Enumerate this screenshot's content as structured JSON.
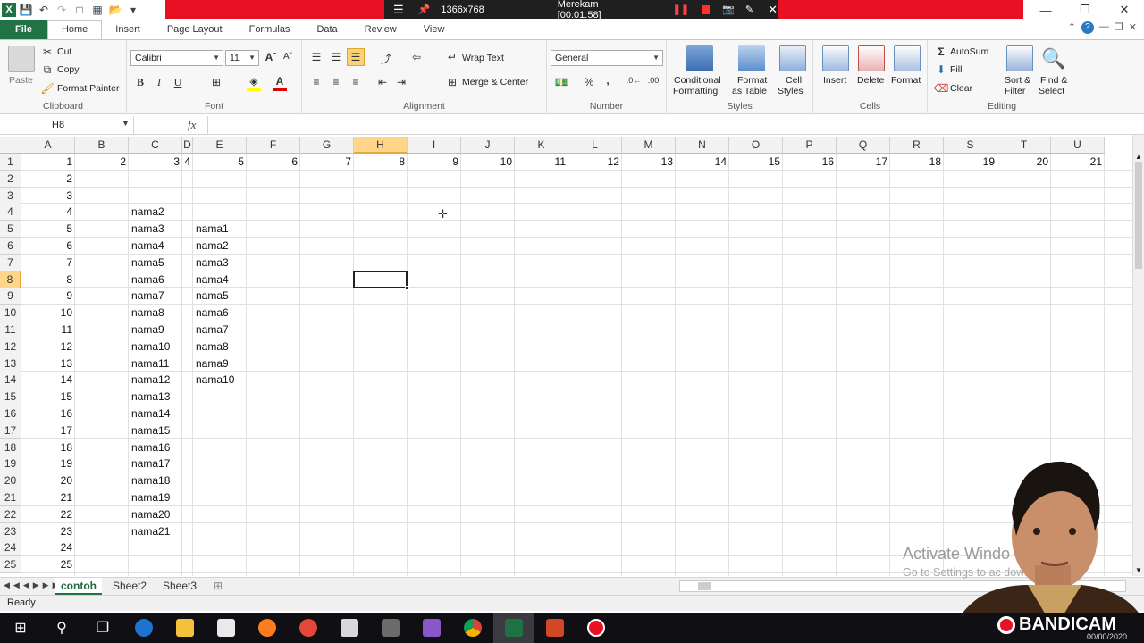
{
  "app": {
    "file_tab": "File",
    "tabs": [
      "Home",
      "Insert",
      "Page Layout",
      "Formulas",
      "Data",
      "Review",
      "View"
    ],
    "active_tab": "Home"
  },
  "recorder": {
    "resolution": "1366x768",
    "status": "Merekam [00:01:58]",
    "brand": "BANDICAM",
    "timestamp_partial": "00/00/2020"
  },
  "ribbon": {
    "clipboard": {
      "label": "Clipboard",
      "paste": "Paste",
      "cut": "Cut",
      "copy": "Copy",
      "format_painter": "Format Painter"
    },
    "font": {
      "label": "Font",
      "name": "Calibri",
      "size": "11",
      "bold": "B",
      "italic": "I",
      "underline": "U"
    },
    "alignment": {
      "label": "Alignment",
      "wrap_text": "Wrap Text",
      "merge_center": "Merge & Center"
    },
    "number": {
      "label": "Number",
      "format": "General",
      "percent": "%",
      "comma": ","
    },
    "styles": {
      "label": "Styles",
      "conditional_1": "Conditional",
      "conditional_2": "Formatting",
      "format_table_1": "Format",
      "format_table_2": "as Table",
      "cell_styles_1": "Cell",
      "cell_styles_2": "Styles"
    },
    "cells": {
      "label": "Cells",
      "insert": "Insert",
      "delete": "Delete",
      "format": "Format"
    },
    "editing": {
      "label": "Editing",
      "autosum": "AutoSum",
      "fill": "Fill",
      "clear": "Clear",
      "sort_1": "Sort &",
      "sort_2": "Filter",
      "find_1": "Find &",
      "find_2": "Select"
    }
  },
  "formula_bar": {
    "name_box": "H8",
    "fx": "fx",
    "content": ""
  },
  "grid": {
    "columns": [
      "A",
      "B",
      "C",
      "D",
      "E",
      "F",
      "G",
      "H",
      "I",
      "J",
      "K",
      "L",
      "M",
      "N",
      "O",
      "P",
      "Q",
      "R",
      "S",
      "T",
      "U"
    ],
    "selected_col": "H",
    "selected_row": 8,
    "rows": [
      "1",
      "2",
      "3",
      "4",
      "5",
      "6",
      "7",
      "8",
      "9",
      "10",
      "11",
      "12",
      "13",
      "14",
      "15",
      "16",
      "17",
      "18",
      "19",
      "20",
      "21",
      "22",
      "23",
      "24",
      "25"
    ],
    "row1_values": [
      "1",
      "2",
      "3",
      "4",
      "5",
      "6",
      "7",
      "8",
      "9",
      "10",
      "11",
      "12",
      "13",
      "14",
      "15",
      "16",
      "17",
      "18",
      "19",
      "20",
      "21"
    ],
    "colA_values": [
      "2",
      "3",
      "4",
      "5",
      "6",
      "7",
      "8",
      "9",
      "10",
      "11",
      "12",
      "13",
      "14",
      "15",
      "16",
      "17",
      "18",
      "19",
      "20",
      "21",
      "22",
      "23",
      "24",
      "25"
    ],
    "colC_values": [
      "nama2",
      "nama3",
      "nama4",
      "nama5",
      "nama6",
      "nama7",
      "nama8",
      "nama9",
      "nama10",
      "nama11",
      "nama12",
      "nama13",
      "nama14",
      "nama15",
      "nama16",
      "nama17",
      "nama18",
      "nama19",
      "nama20",
      "nama21"
    ],
    "colE_values": [
      "nama1",
      "nama2",
      "nama3",
      "nama4",
      "nama5",
      "nama6",
      "nama7",
      "nama8",
      "nama9",
      "nama10"
    ]
  },
  "sheets": {
    "tabs": [
      "contoh",
      "Sheet2",
      "Sheet3"
    ],
    "active": "contoh"
  },
  "status": {
    "text": "Ready"
  },
  "watermark": {
    "line1": "Activate Windo",
    "line2": "Go to Settings to ac        dows."
  }
}
